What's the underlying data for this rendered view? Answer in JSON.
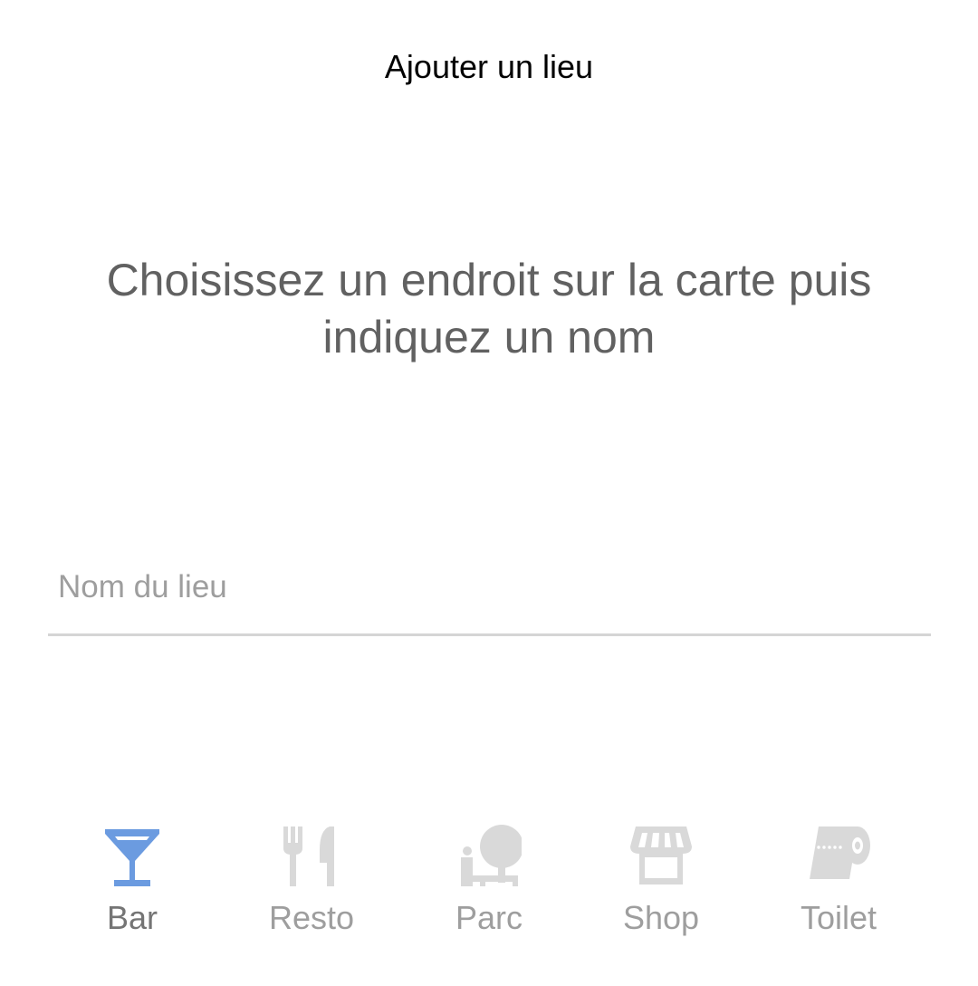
{
  "header": {
    "title": "Ajouter un lieu"
  },
  "instruction": {
    "text": "Choisissez un endroit sur la carte puis indiquez un nom"
  },
  "name_field": {
    "placeholder": "Nom du lieu",
    "value": ""
  },
  "categories": {
    "selected": "Bar",
    "active_color": "#6b9be0",
    "inactive_color": "#d9d9d9",
    "active_label_color": "#757575",
    "inactive_label_color": "#9e9e9e",
    "items": [
      {
        "label": "Bar",
        "icon": "cocktail-glass-icon"
      },
      {
        "label": "Resto",
        "icon": "fork-knife-icon"
      },
      {
        "label": "Parc",
        "icon": "park-tree-icon"
      },
      {
        "label": "Shop",
        "icon": "storefront-icon"
      },
      {
        "label": "Toilet",
        "icon": "toilet-paper-icon"
      }
    ]
  }
}
